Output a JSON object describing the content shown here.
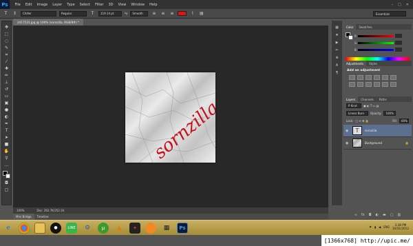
{
  "menubar": {
    "logo": "Ps",
    "items": [
      "File",
      "Edit",
      "Image",
      "Layer",
      "Type",
      "Select",
      "Filter",
      "3D",
      "View",
      "Window",
      "Help"
    ],
    "window_buttons": [
      "–",
      "□",
      "✕"
    ]
  },
  "options": {
    "font_family": "Chiller",
    "font_style": "Regular",
    "font_size": "119.14 pt",
    "aa_label": "ªa",
    "antialias": "Smooth",
    "text_color": "#e01313",
    "workspace": "Essentials"
  },
  "document": {
    "tab_title": "2417531.jpg @ 100% (sornzilla, RGB/8#) *",
    "canvas_text": "sornzilla",
    "canvas_text_color": "#c8101c"
  },
  "status": {
    "zoom": "100%",
    "doc_size": "Doc: 262.7K/352.1K"
  },
  "bottom_tabs": [
    "Mini Bridge",
    "Timeline"
  ],
  "color_panel": {
    "tabs": [
      "Color",
      "Swatches"
    ],
    "channels": [
      "R",
      "G",
      "B"
    ]
  },
  "adjustments_panel": {
    "tabs": [
      "Adjustments",
      "Styles"
    ],
    "title": "Add an adjustment"
  },
  "layers_panel": {
    "tabs": [
      "Layers",
      "Channels",
      "Paths"
    ],
    "kind_filter": "P Kind",
    "blend_mode": "Linear Burn",
    "opacity_label": "Opacity:",
    "opacity": "100%",
    "lock_label": "Lock:",
    "fill_label": "Fill:",
    "fill": "60%",
    "layers": [
      {
        "name": "sornzilla",
        "thumb": "T",
        "selected": true
      },
      {
        "name": "Background",
        "thumb": "",
        "selected": false
      }
    ]
  },
  "taskbar": {
    "language": "ENG",
    "time": "3:38 PM",
    "date": "10/31/2012"
  },
  "caption": "[1366x768] http://upic.me/"
}
